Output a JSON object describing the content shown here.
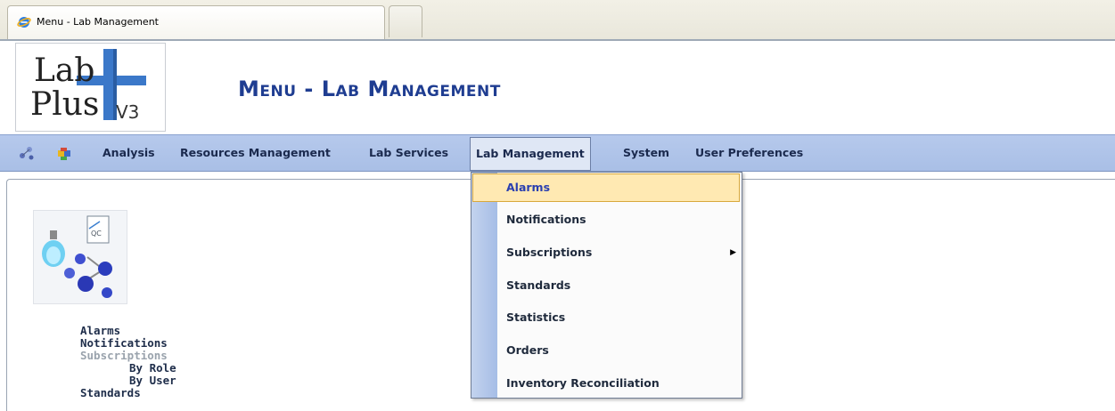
{
  "browser": {
    "tab_title": "Menu - Lab Management"
  },
  "app": {
    "logo": {
      "line1": "Lab",
      "line2": "Plus",
      "version": "V3"
    },
    "page_title": "Menu - Lab Management"
  },
  "menubar": {
    "items": [
      {
        "label": "Analysis"
      },
      {
        "label": "Resources Management"
      },
      {
        "label": "Lab Services"
      },
      {
        "label": "Lab Management",
        "active": true
      },
      {
        "label": "System"
      },
      {
        "label": "User Preferences"
      }
    ]
  },
  "dropdown": {
    "items": [
      {
        "label": "Alarms",
        "highlighted": true
      },
      {
        "label": "Notifications"
      },
      {
        "label": "Subscriptions",
        "has_submenu": true
      },
      {
        "label": "Standards"
      },
      {
        "label": "Statistics"
      },
      {
        "label": "Orders"
      },
      {
        "label": "Inventory Reconciliation"
      }
    ],
    "submenu_arrow": "▶"
  },
  "side_links": {
    "items": [
      {
        "label": "Alarms"
      },
      {
        "label": "Notifications"
      },
      {
        "label": "Subscriptions",
        "disabled": true
      },
      {
        "label": "By Role",
        "indent": true
      },
      {
        "label": "By User",
        "indent": true
      },
      {
        "label": "Standards"
      }
    ]
  },
  "icons": {
    "tab_icon": "ie-icon",
    "menubar_icon_1": "molecules-icon",
    "menubar_icon_2": "puzzle-icon",
    "module_icon": "lab-qc-icon"
  },
  "colors": {
    "title_blue": "#1f3d91",
    "menubar_blue": "#b1c5eb",
    "highlight_fill": "#ffe9b2",
    "highlight_border": "#d8a83c",
    "logo_plus_blue": "#3b78c9"
  }
}
